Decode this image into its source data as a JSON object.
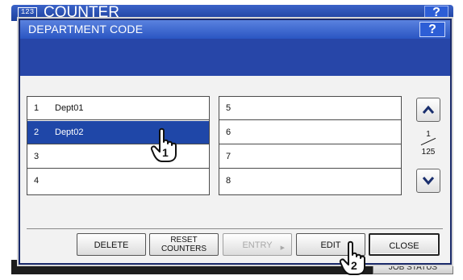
{
  "background": {
    "counter_badge": "123",
    "title": "COUNTER",
    "help_label": "?",
    "job_status_label": "JOB STATUS"
  },
  "dialog": {
    "title": "DEPARTMENT CODE",
    "help_label": "?",
    "list_left": [
      {
        "num": "1",
        "name": "Dept01",
        "selected": false
      },
      {
        "num": "2",
        "name": "Dept02",
        "selected": true
      },
      {
        "num": "3",
        "name": "",
        "selected": false
      },
      {
        "num": "4",
        "name": "",
        "selected": false
      }
    ],
    "list_right": [
      {
        "num": "5",
        "name": ""
      },
      {
        "num": "6",
        "name": ""
      },
      {
        "num": "7",
        "name": ""
      },
      {
        "num": "8",
        "name": ""
      }
    ],
    "pager": {
      "current": "1",
      "total": "125"
    },
    "buttons": {
      "delete": "DELETE",
      "reset_line1": "RESET",
      "reset_line2": "COUNTERS",
      "entry": "ENTRY",
      "edit": "EDIT",
      "close": "CLOSE"
    }
  },
  "callouts": {
    "step1": "1",
    "step2": "2"
  }
}
